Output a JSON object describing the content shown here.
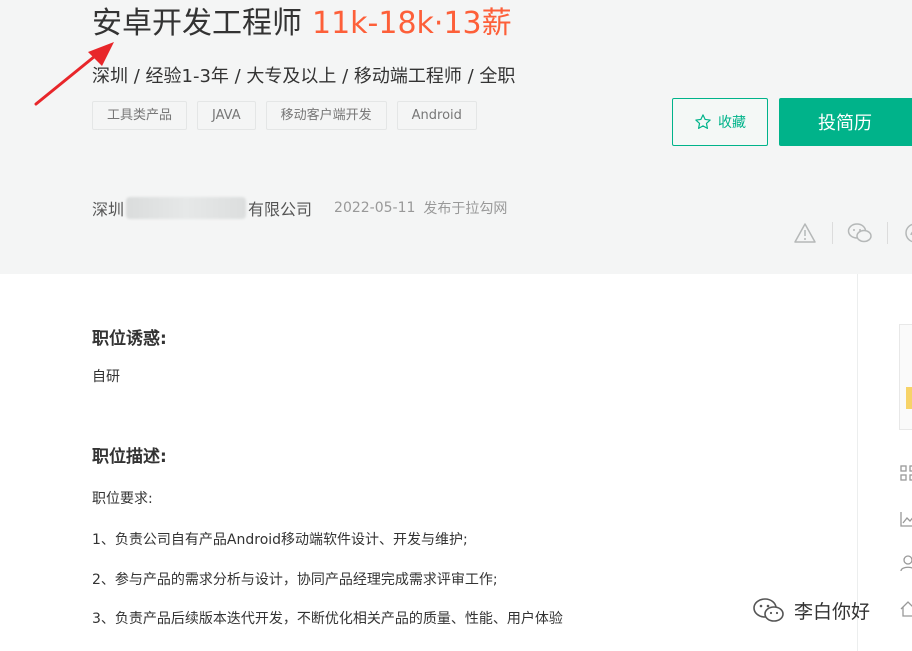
{
  "job": {
    "title": "安卓开发工程师",
    "salary": "11k-18k·13薪",
    "requirements": "深圳 / 经验1-3年 / 大专及以上 / 移动端工程师 / 全职",
    "tags": [
      "工具类产品",
      "JAVA",
      "移动客户端开发",
      "Android"
    ]
  },
  "actions": {
    "favorite_label": "收藏",
    "apply_label": "投简历"
  },
  "company": {
    "name_prefix": "深圳",
    "name_suffix": "有限公司",
    "date": "2022-05-11",
    "published": "发布于拉勾网"
  },
  "share": {
    "icons": [
      "warning-icon",
      "wechat-icon",
      "weibo-icon"
    ]
  },
  "details": {
    "perks_title": "职位诱惑:",
    "perks_text": "自研",
    "description_title": "职位描述:",
    "requirements_heading": "职位要求:",
    "items": [
      "1、负责公司自有产品Android移动端软件设计、开发与维护;",
      "2、参与产品的需求分析与设计，协同产品经理完成需求评审工作;",
      "3、负责产品后续版本迭代开发，不断优化相关产品的质量、性能、用户体验"
    ]
  },
  "watermark": {
    "text": "李白你好"
  },
  "colors": {
    "accent": "#00b38a",
    "salary": "#fd5f39",
    "arrow": "#e8262a"
  }
}
